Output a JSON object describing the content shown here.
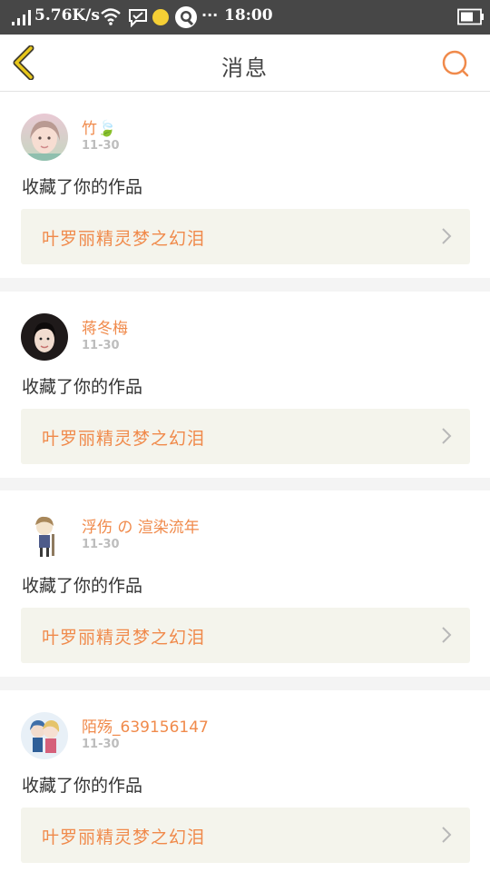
{
  "status_bar": {
    "net_speed": "5.76K/s",
    "more": "···",
    "time": "18:00",
    "icons": [
      "signal-icon",
      "wifi-icon",
      "chat-icon",
      "yellow-dot-icon",
      "qq-icon",
      "battery-icon"
    ]
  },
  "header": {
    "title": "消息",
    "accent_color": "#f08a4b",
    "back_icon_color": "#e8c71a"
  },
  "messages": [
    {
      "username": "竹🍃",
      "date": "11-30",
      "action": "收藏了你的作品",
      "work_title": "叶罗丽精灵梦之幻泪",
      "avatar": "girl-photo-avatar"
    },
    {
      "username": "蒋冬梅",
      "date": "11-30",
      "action": "收藏了你的作品",
      "work_title": "叶罗丽精灵梦之幻泪",
      "avatar": "woman-photo-avatar"
    },
    {
      "username": "浮伤 の 渲染流年",
      "date": "11-30",
      "action": "收藏了你的作品",
      "work_title": "叶罗丽精灵梦之幻泪",
      "avatar": "anime-character-avatar"
    },
    {
      "username": "陌殇_639156147",
      "date": "11-30",
      "action": "收藏了你的作品",
      "work_title": "叶罗丽精灵梦之幻泪",
      "avatar": "anime-couple-avatar"
    }
  ]
}
